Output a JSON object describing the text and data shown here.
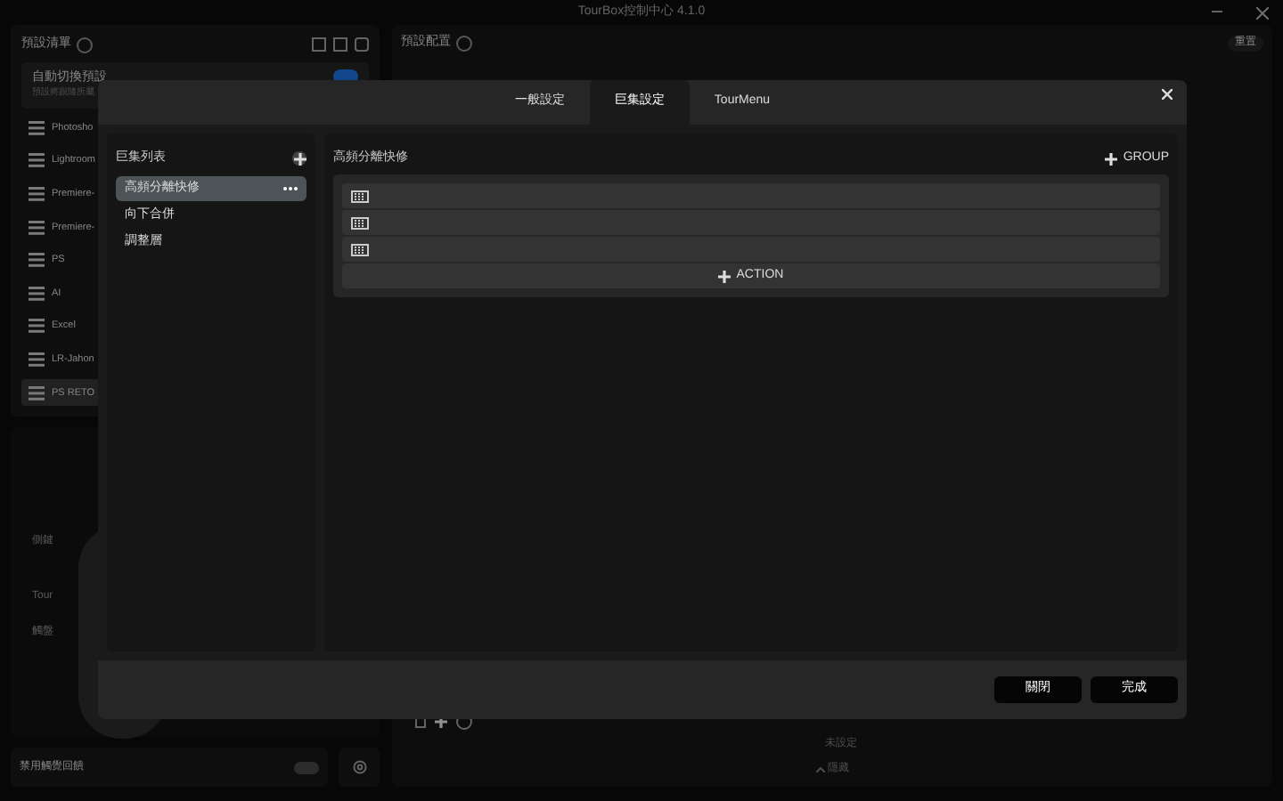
{
  "window": {
    "title": "TourBox控制中心 4.1.0"
  },
  "presets": {
    "title": "預設清單",
    "auto_switch": {
      "label": "自動切換預設",
      "hint": "預設將跟隨所屬",
      "on": true
    },
    "items": [
      {
        "name": "Photosho",
        "selected": false
      },
      {
        "name": "Lightroom",
        "selected": false
      },
      {
        "name": "Premiere-",
        "selected": false
      },
      {
        "name": "Premiere-",
        "selected": false
      },
      {
        "name": "PS",
        "selected": false
      },
      {
        "name": "AI",
        "selected": false
      },
      {
        "name": "Excel",
        "selected": false
      },
      {
        "name": "LR-Jahon",
        "selected": false
      },
      {
        "name": "PS RETO",
        "selected": true
      }
    ]
  },
  "device": {
    "labels": [
      "側鍵",
      "Tour",
      "觸盤"
    ]
  },
  "haptics": {
    "label": "禁用觸覺回饋",
    "on": false
  },
  "config": {
    "title": "預設配置",
    "reset": "重置",
    "unset": "未設定",
    "hide": "隱藏"
  },
  "dialog": {
    "tabs": [
      {
        "label": "一般設定",
        "selected": false
      },
      {
        "label": "巨集設定",
        "selected": true
      },
      {
        "label": "TourMenu",
        "selected": false
      }
    ],
    "macro_list": {
      "title": "巨集列表",
      "items": [
        {
          "name": "高頻分離快修",
          "selected": true
        },
        {
          "name": "向下合併",
          "selected": false
        },
        {
          "name": "調整層",
          "selected": false
        }
      ]
    },
    "macro": {
      "title": "高頻分離快修",
      "add_group": "GROUP",
      "actions": [
        {
          "kind": "keyboard"
        },
        {
          "kind": "keyboard"
        },
        {
          "kind": "keyboard"
        }
      ],
      "add_action": "ACTION"
    },
    "buttons": [
      {
        "label": "關閉"
      },
      {
        "label": "完成"
      }
    ]
  }
}
